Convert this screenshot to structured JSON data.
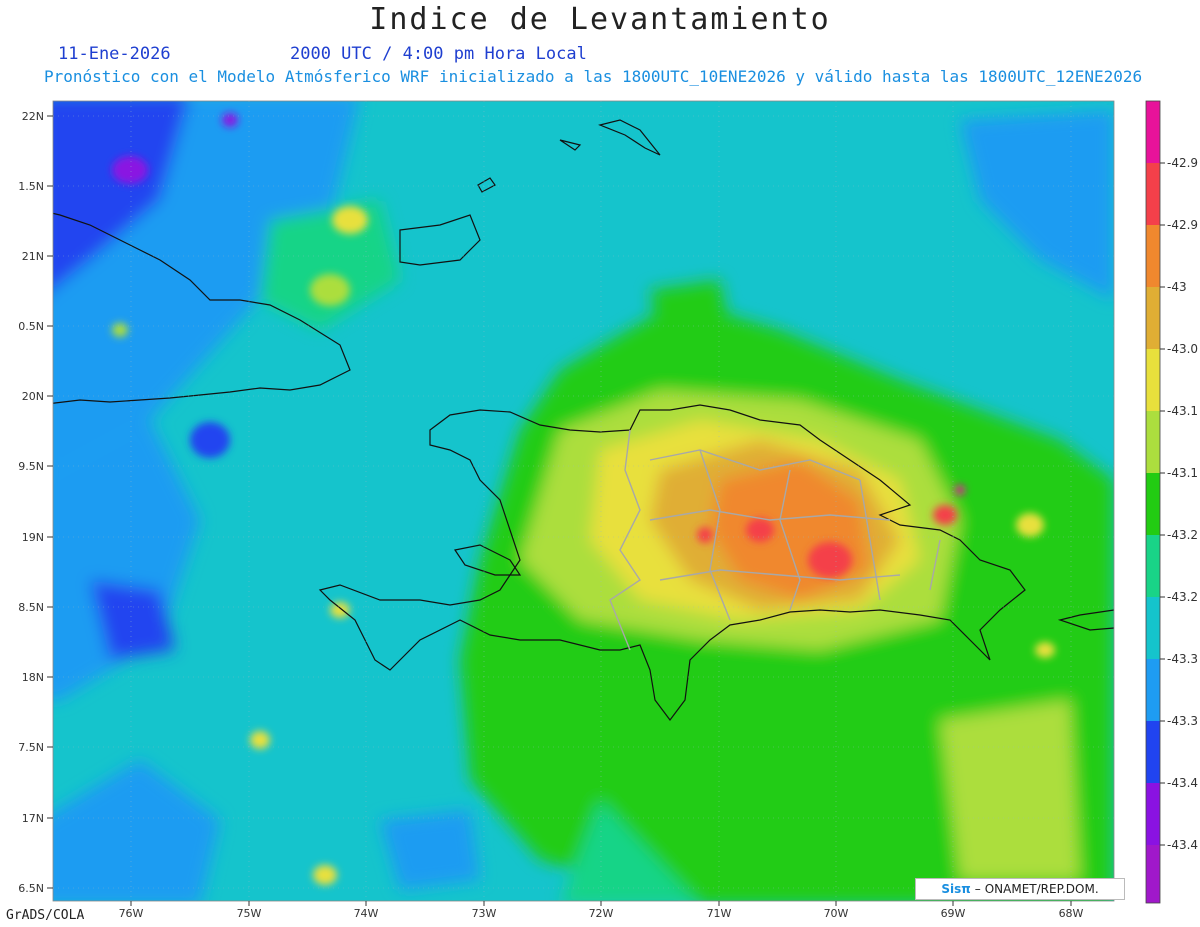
{
  "title": "Indice de Levantamiento",
  "date": "11-Ene-2026",
  "time": "2000 UTC / 4:00 pm Hora Local",
  "subtitle": "Pronóstico con el Modelo Atmósferico WRF inicializado a las 1800UTC_10ENE2026 y válido hasta las  1800UTC_12ENE2026",
  "footer_left": "GrADS/COLA",
  "credit": {
    "logo": "Sisπ",
    "sep": "–",
    "org": "ONAMET/REP.DOM."
  },
  "lat_labels": [
    "22N",
    "1.5N",
    "21N",
    "0.5N",
    "20N",
    "9.5N",
    "19N",
    "8.5N",
    "18N",
    "7.5N",
    "17N",
    "6.5N"
  ],
  "lon_labels": [
    "76W",
    "75W",
    "74W",
    "73W",
    "72W",
    "71W",
    "70W",
    "69W",
    "68W"
  ],
  "colorbar": {
    "labels": [
      "-42.9",
      "-42.9",
      "-43",
      "-43.0",
      "-43.1",
      "-43.1",
      "-43.2",
      "-43.2",
      "-43.3",
      "-43.3",
      "-43.4",
      "-43.4"
    ],
    "colors": [
      "#e8129a",
      "#f4404a",
      "#f0882e",
      "#e0ae34",
      "#e8e03c",
      "#acde3e",
      "#22cc12",
      "#19d487",
      "#15c4cc",
      "#1e9cf2",
      "#2044f0",
      "#8a12e2",
      "#a018ca"
    ]
  }
}
